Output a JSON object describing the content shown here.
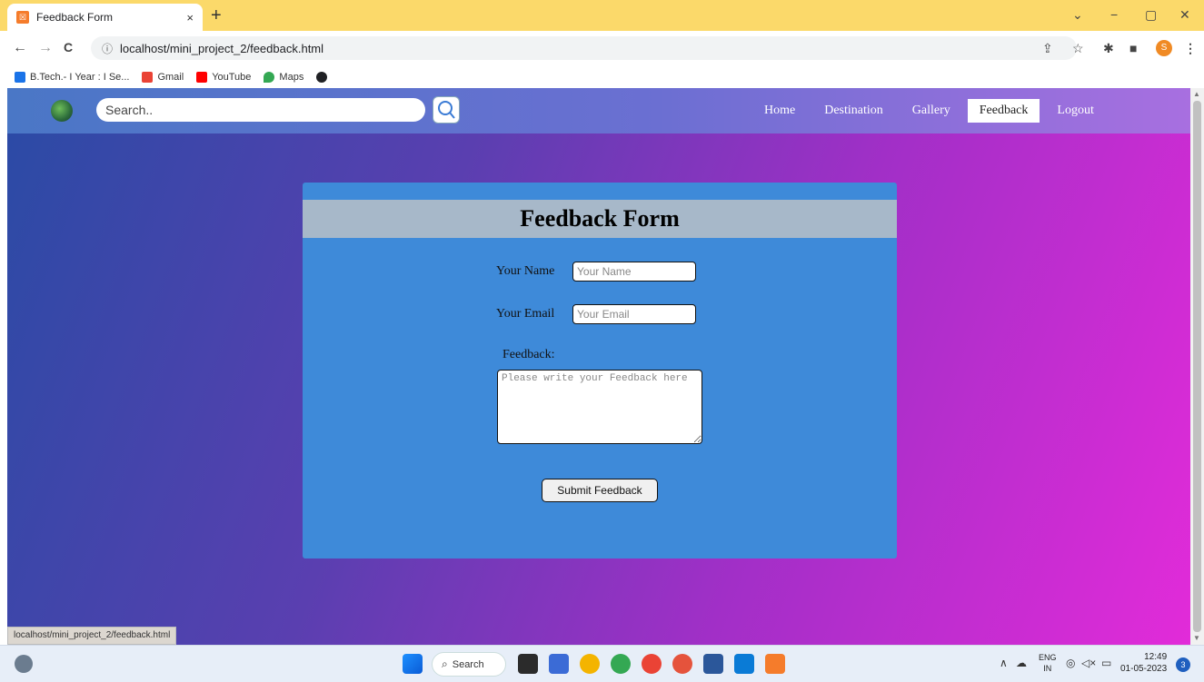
{
  "browser": {
    "tab_title": "Feedback Form",
    "tab_close": "×",
    "new_tab": "+",
    "window_controls": {
      "minimize": "−",
      "restore": "▢",
      "close": "✕",
      "dropdown": "⌄"
    },
    "nav": {
      "back": "←",
      "forward": "→",
      "reload": "C"
    },
    "url": "localhost/mini_project_2/feedback.html",
    "profile_initial": "S",
    "bookmarks": [
      {
        "label": "B.Tech.- I Year : I Se...",
        "color": "#1a73e8"
      },
      {
        "label": "Gmail",
        "color": "#ea4335"
      },
      {
        "label": "YouTube",
        "color": "#ff0000"
      },
      {
        "label": "Maps",
        "color": "#34a853"
      },
      {
        "label": "",
        "color": "#202124"
      }
    ]
  },
  "site": {
    "search_placeholder": "Search..",
    "nav_links": [
      "Home",
      "Destination",
      "Gallery",
      "Feedback",
      "Logout"
    ],
    "active_link": "Feedback"
  },
  "form": {
    "title": "Feedback Form",
    "name_label": "Your Name",
    "name_placeholder": "Your Name",
    "email_label": "Your Email",
    "email_placeholder": "Your Email",
    "feedback_label": "Feedback:",
    "feedback_placeholder": "Please write your Feedback here",
    "submit_label": "Submit Feedback"
  },
  "status_url": "localhost/mini_project_2/feedback.html",
  "taskbar": {
    "search_label": "Search",
    "lang_top": "ENG",
    "lang_bottom": "IN",
    "time": "12:49",
    "date": "01-05-2023",
    "notification_count": "3"
  },
  "colors": {
    "tabbar": "#fbd96a",
    "card": "#3e8ad9",
    "card_header": "#a7b8c9",
    "gradient_start": "#2a4ba5",
    "gradient_end": "#e22bd9"
  }
}
